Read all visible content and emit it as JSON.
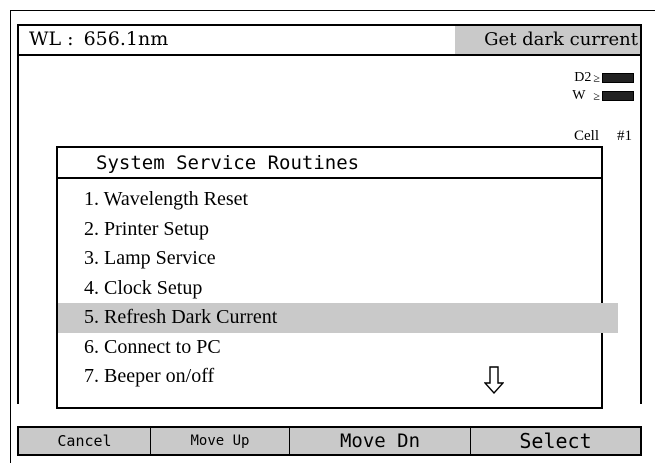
{
  "header": {
    "wl_label": "WL :",
    "wl_value": "656.1nm",
    "status": "Get dark current"
  },
  "lamps": {
    "d2_label": "D2",
    "w_label": "W",
    "symbol": "≥",
    "cell_label": "Cell",
    "cell_number": "#1"
  },
  "dialog": {
    "title": "System Service Routines",
    "items": [
      {
        "label": "1. Wavelength Reset"
      },
      {
        "label": "2. Printer Setup"
      },
      {
        "label": "3. Lamp Service"
      },
      {
        "label": "4. Clock Setup"
      },
      {
        "label": "5. Refresh Dark Current"
      },
      {
        "label": "6. Connect to PC"
      },
      {
        "label": "7. Beeper on/off"
      }
    ],
    "selected_index": 4,
    "scroll_icon": "down-arrow-icon"
  },
  "softkeys": [
    {
      "label": "Cancel"
    },
    {
      "label": "Move Up"
    },
    {
      "label": "Move Dn"
    },
    {
      "label": "Select"
    }
  ],
  "colors": {
    "highlight": "#c9c9c9",
    "foreground": "#000000",
    "background": "#ffffff"
  }
}
